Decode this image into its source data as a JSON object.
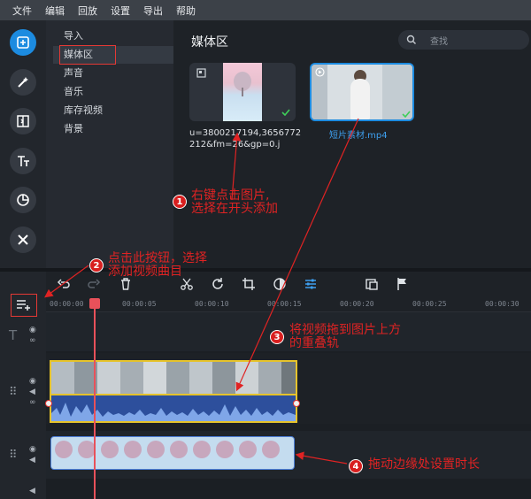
{
  "menu": [
    "文件",
    "编辑",
    "回放",
    "设置",
    "导出",
    "帮助"
  ],
  "tools": [
    "import-icon",
    "magic-wand-icon",
    "transition-icon",
    "titles-icon",
    "stickers-icon",
    "tools-icon"
  ],
  "categories": [
    "导入",
    "媒体区",
    "声音",
    "音乐",
    "库存视频",
    "背景"
  ],
  "selected_category": "媒体区",
  "media": {
    "title": "媒体区",
    "search_placeholder": "查找",
    "items": [
      {
        "name": "u=3800217194,3656772212&fm=26&gp=0.j",
        "type": "image"
      },
      {
        "name": "短片素材.mp4",
        "type": "video"
      }
    ]
  },
  "ruler_ticks": [
    "00:00:00",
    "00:00:05",
    "00:00:10",
    "00:00:15",
    "00:00:20",
    "00:00:25",
    "00:00:30"
  ],
  "annotations": [
    {
      "num": "1",
      "text_line1": "右键点击图片,",
      "text_line2": "选择在开头添加"
    },
    {
      "num": "2",
      "text_line1": "点击此按钮，选择",
      "text_line2": "添加视频曲目"
    },
    {
      "num": "3",
      "text_line1": "将视频拖到图片上方",
      "text_line2": "的重叠轨"
    },
    {
      "num": "4",
      "text_line1": "拖动边缘处设置时长",
      "text_line2": ""
    }
  ],
  "colors": {
    "accent": "#1c8be0",
    "annotation": "#e02323",
    "clip_border": "#e6c32b"
  }
}
